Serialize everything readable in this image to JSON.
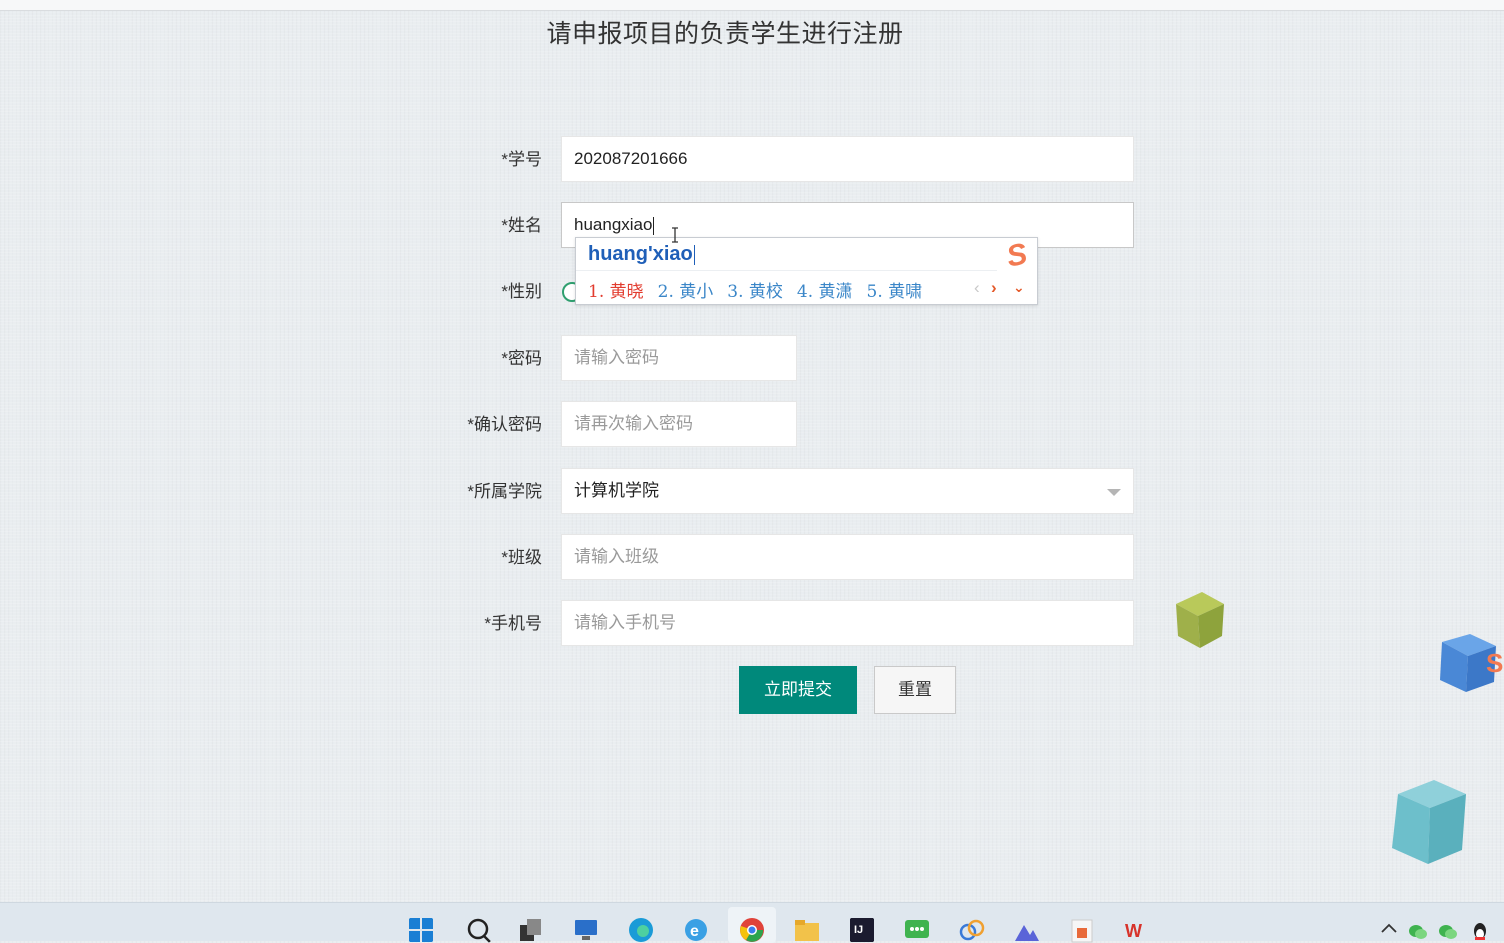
{
  "page": {
    "title": "请申报项目的负责学生进行注册"
  },
  "form": {
    "student_id": {
      "label": "*学号",
      "value": "202087201666"
    },
    "name": {
      "label": "*姓名",
      "value": "huangxiao"
    },
    "gender": {
      "label": "*性别"
    },
    "password": {
      "label": "*密码",
      "placeholder": "请输入密码"
    },
    "confirm_password": {
      "label": "*确认密码",
      "placeholder": "请再次输入密码"
    },
    "college": {
      "label": "*所属学院",
      "value": "计算机学院"
    },
    "class": {
      "label": "*班级",
      "placeholder": "请输入班级"
    },
    "phone": {
      "label": "*手机号",
      "placeholder": "请输入手机号"
    },
    "submit_label": "立即提交",
    "reset_label": "重置"
  },
  "ime": {
    "pinyin": "huang'xiao",
    "logo": "S",
    "candidates": [
      "1. 黄晓",
      "2. 黄小",
      "3. 黄校",
      "4. 黄潇",
      "5. 黄啸"
    ],
    "prev_icon": "‹",
    "next_icon": "›",
    "expand_icon": "⌄"
  },
  "taskbar": {
    "icons": [
      "windows-start-icon",
      "search-icon",
      "task-view-icon",
      "remote-desktop-icon",
      "edge-icon",
      "ie-icon",
      "chrome-icon",
      "file-explorer-icon",
      "intellij-icon",
      "wechat-work-icon",
      "app-icon",
      "photos-icon",
      "powerpoint-icon",
      "wps-icon"
    ],
    "tray_icons": [
      "chevron-up-icon",
      "wechat-icon",
      "wechat-icon-2",
      "qq-icon"
    ]
  },
  "colors": {
    "primary": "#00897b",
    "ime_pinyin": "#1f5fb8",
    "ime_first_candidate": "#e23c2f",
    "ime_candidate": "#3a86c8"
  }
}
